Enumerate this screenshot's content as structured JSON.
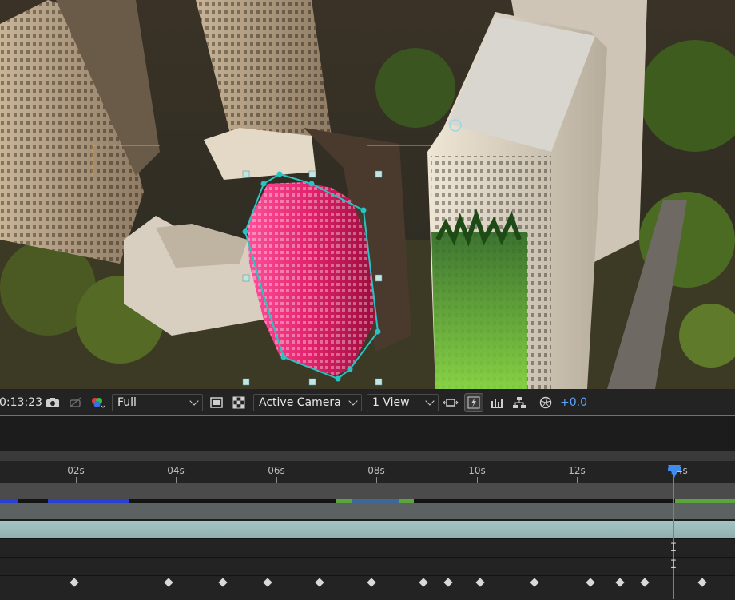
{
  "viewer": {
    "description_icon": "composition-viewer"
  },
  "toolbar": {
    "timecode": "0:13:23",
    "resolution": "Full",
    "camera": "Active Camera",
    "views": "1 View",
    "exposure": "+0.0",
    "icons": [
      "camera-snapshot-icon",
      "show-snapshot-icon",
      "color-channels-icon",
      "region-of-interest-icon",
      "transparency-grid-icon",
      "reset-view-icon",
      "fast-preview-icon",
      "timeline-icon",
      "flowchart-icon",
      "exposure-icon"
    ]
  },
  "timeline": {
    "ruler_labels": [
      "02s",
      "04s",
      "06s",
      "08s",
      "10s",
      "12s",
      "14s"
    ],
    "current_time_seconds": 13.77,
    "keyframe_count": 14
  },
  "colors": {
    "accent": "#3f8cf0",
    "mask_path": "#28c4c4",
    "cache_blue": "#2a3fd8",
    "cache_green": "#5aa63a"
  }
}
